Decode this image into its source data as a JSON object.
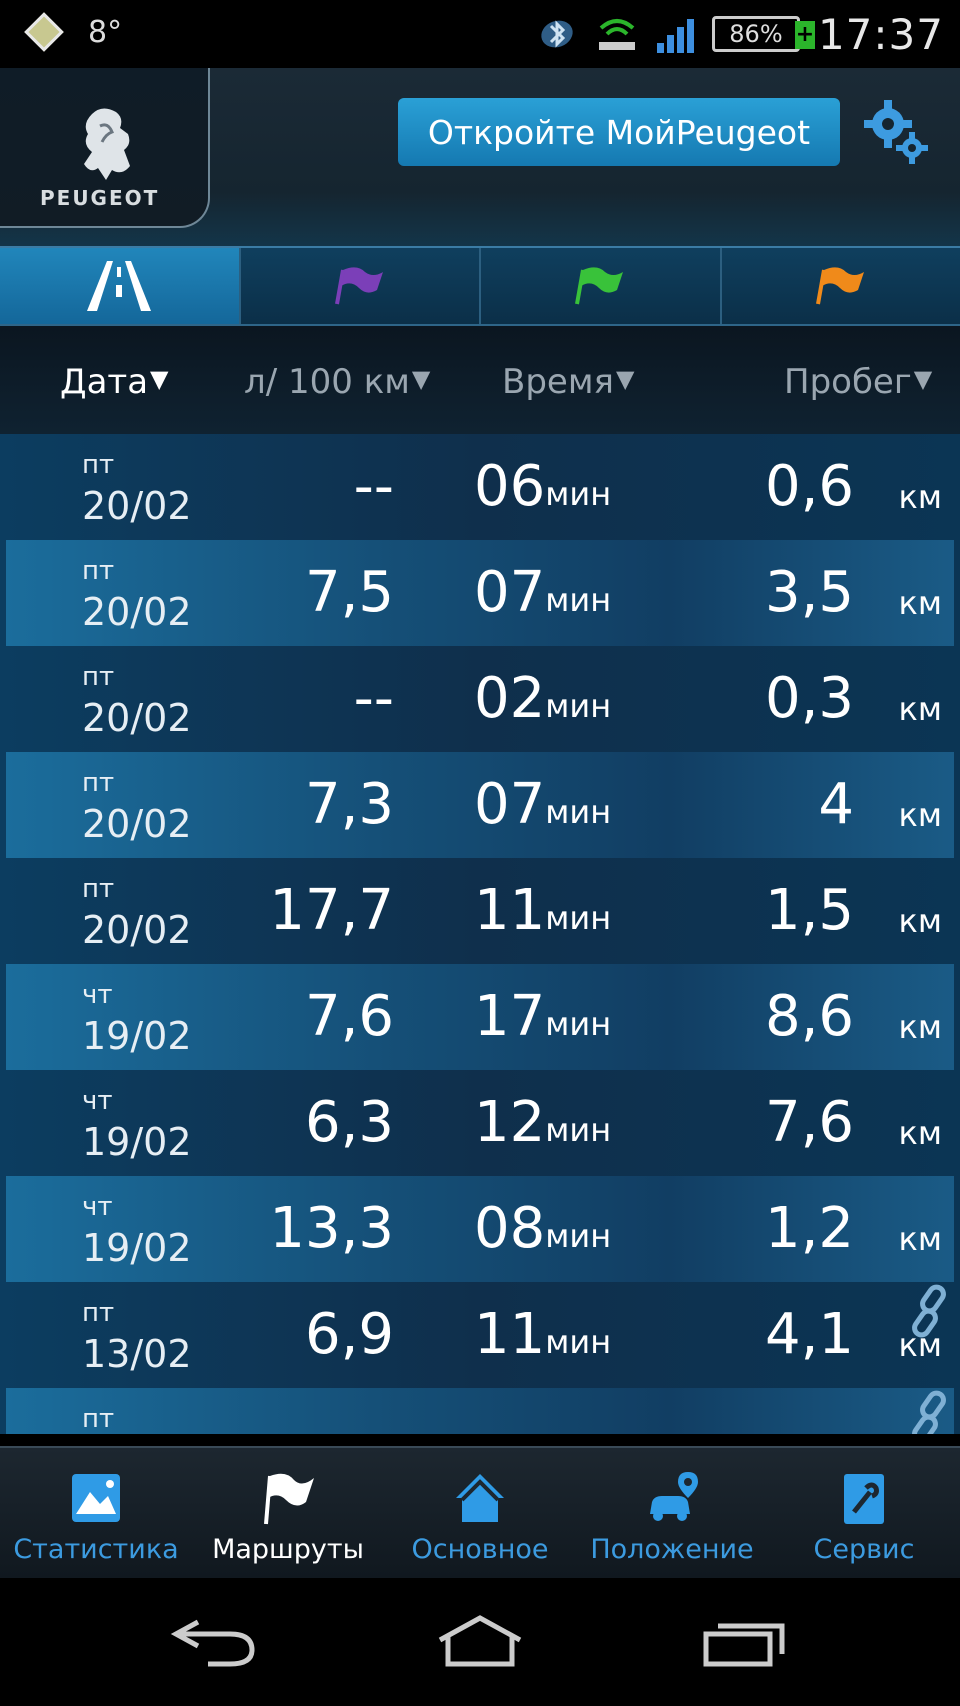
{
  "status_bar": {
    "temperature": "8°",
    "battery": "86%",
    "time": "17:37"
  },
  "header": {
    "brand": "PEUGEOT",
    "my_peugeot_button": "Откройте МойPeugeot"
  },
  "tabs": [
    {
      "icon": "road-icon",
      "active": true
    },
    {
      "icon": "flag-purple-icon",
      "color": "#7b3fb8"
    },
    {
      "icon": "flag-green-icon",
      "color": "#39c23a"
    },
    {
      "icon": "flag-orange-icon",
      "color": "#f08a1a"
    }
  ],
  "columns": {
    "date": "Дата",
    "consumption": "л/ 100 км",
    "time": "Время",
    "distance": "Пробег"
  },
  "units": {
    "minutes": "мин",
    "km": "км"
  },
  "trips": [
    {
      "day": "пт",
      "date": "20/02",
      "consumption": "--",
      "time": "06",
      "distance": "0,6"
    },
    {
      "day": "пт",
      "date": "20/02",
      "consumption": "7,5",
      "time": "07",
      "distance": "3,5"
    },
    {
      "day": "пт",
      "date": "20/02",
      "consumption": "--",
      "time": "02",
      "distance": "0,3"
    },
    {
      "day": "пт",
      "date": "20/02",
      "consumption": "7,3",
      "time": "07",
      "distance": "4"
    },
    {
      "day": "пт",
      "date": "20/02",
      "consumption": "17,7",
      "time": "11",
      "distance": "1,5"
    },
    {
      "day": "чт",
      "date": "19/02",
      "consumption": "7,6",
      "time": "17",
      "distance": "8,6"
    },
    {
      "day": "чт",
      "date": "19/02",
      "consumption": "6,3",
      "time": "12",
      "distance": "7,6"
    },
    {
      "day": "чт",
      "date": "19/02",
      "consumption": "13,3",
      "time": "08",
      "distance": "1,2"
    },
    {
      "day": "пт",
      "date": "13/02",
      "consumption": "6,9",
      "time": "11",
      "distance": "4,1",
      "linked": true
    },
    {
      "day": "пт",
      "date": "",
      "consumption": "",
      "time": "",
      "distance": "",
      "linked": true
    }
  ],
  "bottom_nav": [
    {
      "label": "Статистика",
      "icon": "statistics-icon"
    },
    {
      "label": "Маршруты",
      "icon": "routes-flag-icon",
      "active": true
    },
    {
      "label": "Основное",
      "icon": "home-icon"
    },
    {
      "label": "Положение",
      "icon": "car-location-icon"
    },
    {
      "label": "Сервис",
      "icon": "service-wrench-icon"
    }
  ],
  "colors": {
    "accent": "#2aa0d6",
    "nav_label": "#3c9be0"
  }
}
